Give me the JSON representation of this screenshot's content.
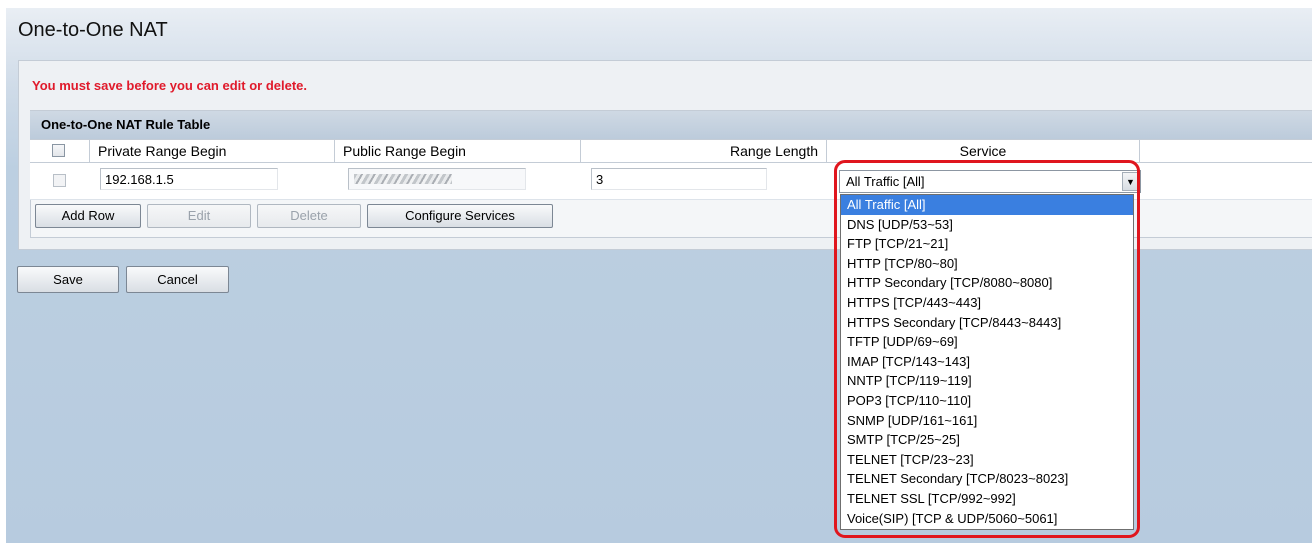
{
  "page": {
    "title": "One-to-One NAT"
  },
  "message": {
    "warning": "You must save before you can edit or delete."
  },
  "table": {
    "caption": "One-to-One NAT Rule Table",
    "headers": {
      "private": "Private Range Begin",
      "public": "Public Range Begin",
      "length": "Range Length",
      "service": "Service"
    },
    "row": {
      "private_value": "192.168.1.5",
      "public_value": "",
      "length_value": "3",
      "service_value": "All Traffic [All]"
    },
    "buttons": {
      "add_row": "Add Row",
      "edit": "Edit",
      "delete": "Delete",
      "configure_services": "Configure Services"
    }
  },
  "service_options": [
    "All Traffic [All]",
    "DNS [UDP/53~53]",
    "FTP [TCP/21~21]",
    "HTTP [TCP/80~80]",
    "HTTP Secondary [TCP/8080~8080]",
    "HTTPS [TCP/443~443]",
    "HTTPS Secondary [TCP/8443~8443]",
    "TFTP [UDP/69~69]",
    "IMAP [TCP/143~143]",
    "NNTP [TCP/119~119]",
    "POP3 [TCP/110~110]",
    "SNMP [UDP/161~161]",
    "SMTP [TCP/25~25]",
    "TELNET [TCP/23~23]",
    "TELNET Secondary [TCP/8023~8023]",
    "TELNET SSL [TCP/992~992]",
    "Voice(SIP) [TCP & UDP/5060~5061]"
  ],
  "footer": {
    "save": "Save",
    "cancel": "Cancel"
  },
  "colors": {
    "warning": "#e01a2b",
    "highlight": "#e0161e",
    "selection": "#3a7fe0"
  }
}
